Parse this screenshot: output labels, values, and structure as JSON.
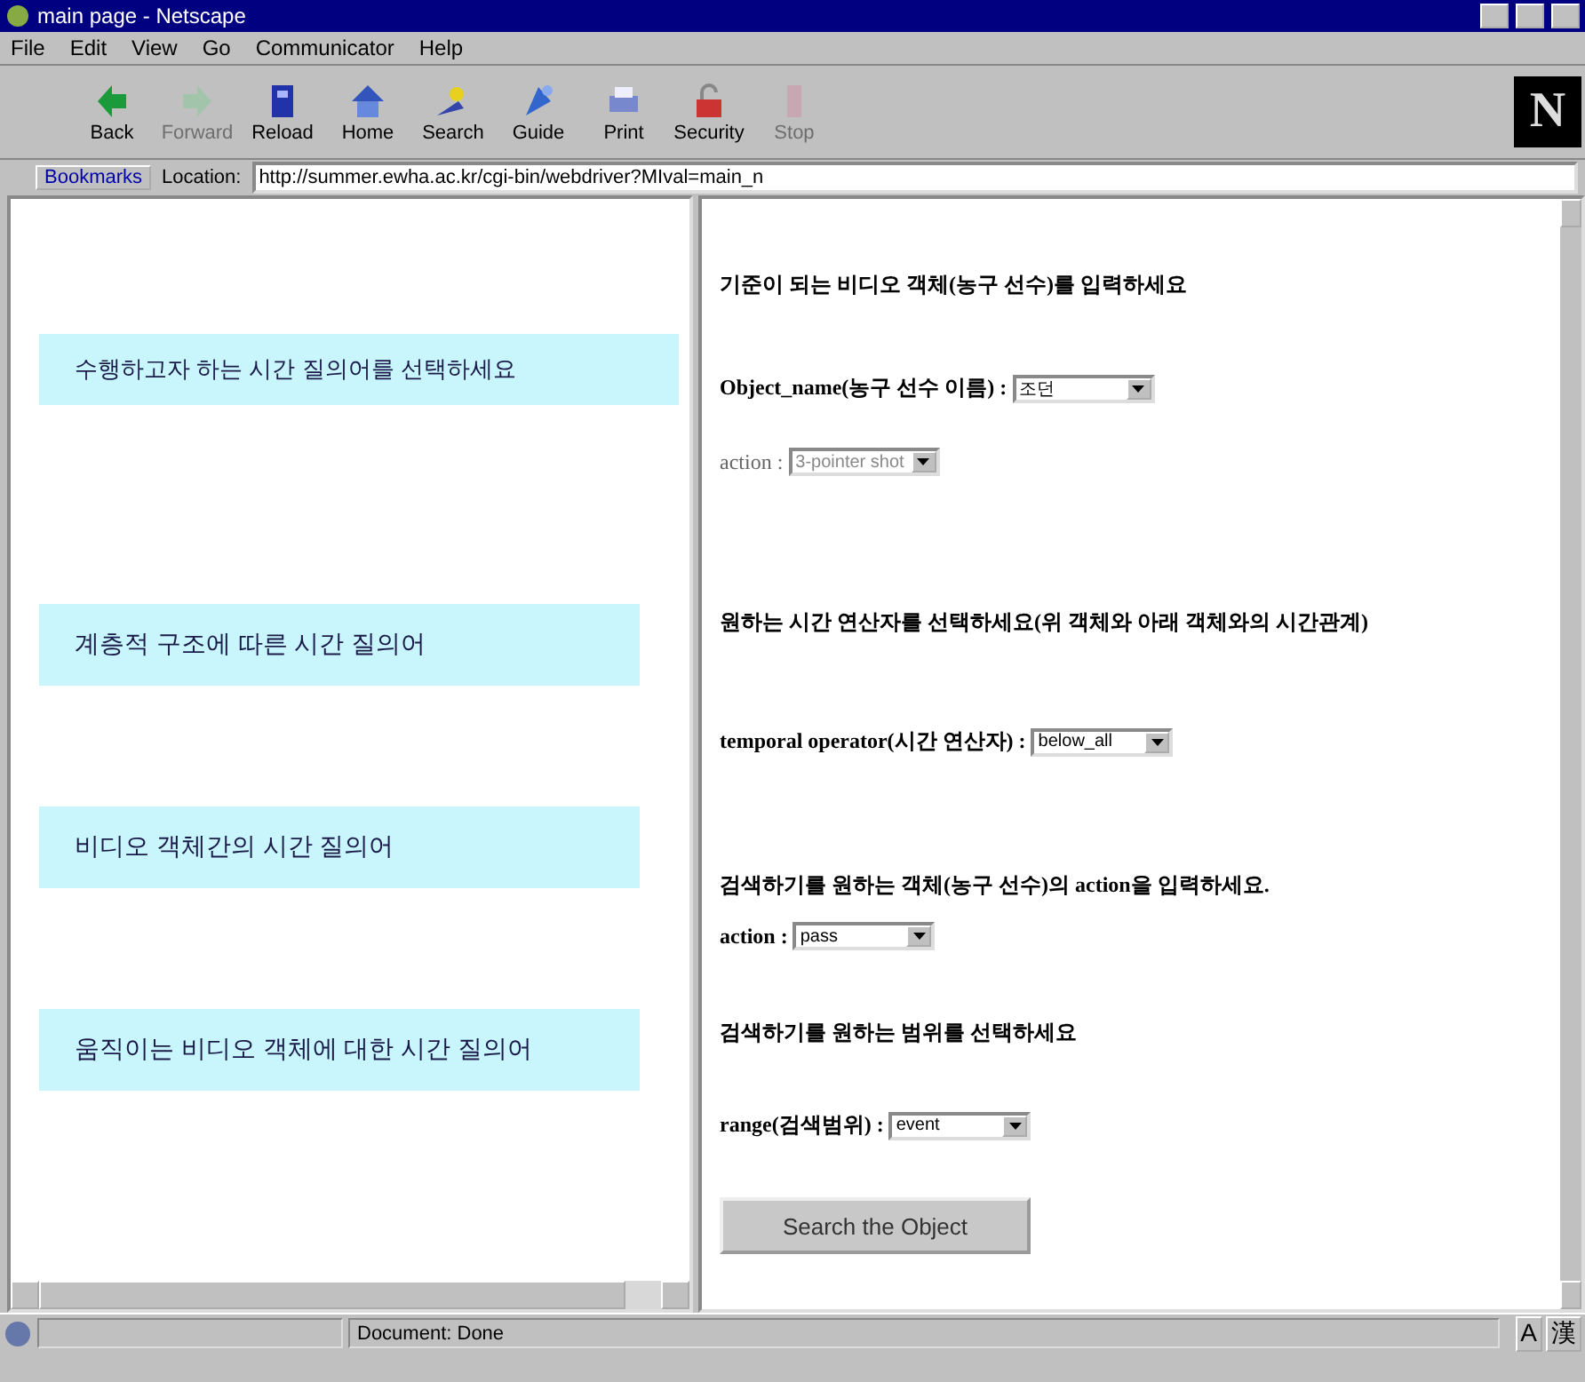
{
  "window": {
    "title": "main page - Netscape"
  },
  "menu": [
    "File",
    "Edit",
    "View",
    "Go",
    "Communicator",
    "Help"
  ],
  "toolbar": [
    {
      "kind": "back",
      "label": "Back",
      "disabled": false
    },
    {
      "kind": "forward",
      "label": "Forward",
      "disabled": true
    },
    {
      "kind": "reload",
      "label": "Reload",
      "disabled": false
    },
    {
      "kind": "home",
      "label": "Home",
      "disabled": false
    },
    {
      "kind": "search",
      "label": "Search",
      "disabled": false
    },
    {
      "kind": "guide",
      "label": "Guide",
      "disabled": false
    },
    {
      "kind": "print",
      "label": "Print",
      "disabled": false
    },
    {
      "kind": "security",
      "label": "Security",
      "disabled": false
    },
    {
      "kind": "stop",
      "label": "Stop",
      "disabled": true
    }
  ],
  "logo": "N",
  "location_bar": {
    "bookmarks": "Bookmarks",
    "label": "Location:",
    "url": "http://summer.ewha.ac.kr/cgi-bin/webdriver?MIval=main_n"
  },
  "left_frame": {
    "items": [
      {
        "kind": "heading",
        "text": "수행하고자 하는 시간 질의어를 선택하세요"
      },
      {
        "kind": "link",
        "text": "계층적 구조에 따른 시간 질의어"
      },
      {
        "kind": "link",
        "text": "비디오 객체간의 시간 질의어"
      },
      {
        "kind": "link",
        "text": "움직이는 비디오 객체에 대한 시간 질의어"
      }
    ]
  },
  "right_frame": {
    "items": [
      {
        "kind": "text",
        "text": "기준이 되는 비디오 객체(농구 선수)를 입력하세요"
      },
      {
        "kind": "select",
        "label": "Object_name(농구 선수 이름) :",
        "value": "조던",
        "disabled": false
      },
      {
        "kind": "select",
        "label": "action :",
        "value": "3-pointer shot",
        "disabled": true
      },
      {
        "kind": "text",
        "text": "원하는 시간 연산자를 선택하세요(위 객체와 아래 객체와의 시간관계)"
      },
      {
        "kind": "select",
        "label": "temporal operator(시간 연산자) :",
        "value": "below_all",
        "disabled": false
      },
      {
        "kind": "text",
        "text": "검색하기를 원하는 객체(농구 선수)의 action을 입력하세요."
      },
      {
        "kind": "select",
        "label": "action :",
        "value": "pass",
        "disabled": false
      },
      {
        "kind": "text",
        "text": "검색하기를 원하는 범위를 선택하세요"
      },
      {
        "kind": "select",
        "label": "range(검색범위) :",
        "value": "event",
        "disabled": false
      },
      {
        "kind": "button",
        "text": "Search the Object"
      }
    ]
  },
  "status_bar": {
    "text": "Document: Done",
    "ime": [
      "A",
      "漢"
    ]
  }
}
